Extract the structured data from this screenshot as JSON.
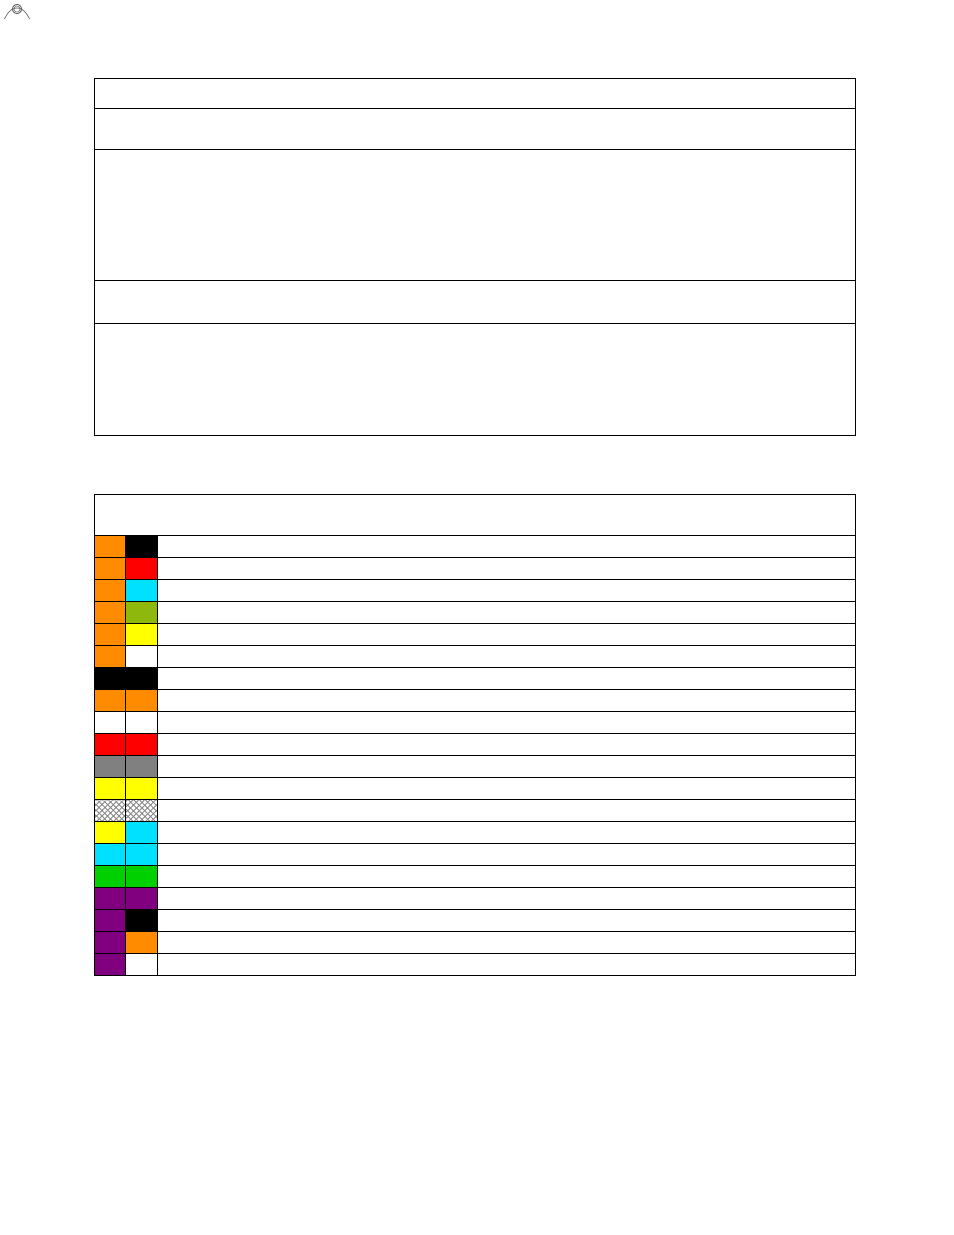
{
  "logo": {
    "name": "mgm-lion-logo"
  },
  "table1": {
    "rows": [
      {
        "id": "r1",
        "content": ""
      },
      {
        "id": "r2",
        "content": ""
      },
      {
        "id": "r3",
        "content": ""
      },
      {
        "id": "r4",
        "content": ""
      },
      {
        "id": "r5",
        "content": ""
      }
    ]
  },
  "table2": {
    "header": "",
    "colors": {
      "orange": "#ff8c00",
      "black": "#000000",
      "red": "#ff0000",
      "cyan": "#00e0ff",
      "olive": "#8fb80d",
      "yellow": "#ffff00",
      "white": "#ffffff",
      "gray": "#808080",
      "green": "#00d000",
      "purple": "#800080"
    },
    "rows": [
      {
        "c1": "orange",
        "c2": "black",
        "label": ""
      },
      {
        "c1": "orange",
        "c2": "red",
        "label": ""
      },
      {
        "c1": "orange",
        "c2": "cyan",
        "label": ""
      },
      {
        "c1": "orange",
        "c2": "olive",
        "label": ""
      },
      {
        "c1": "orange",
        "c2": "yellow",
        "label": ""
      },
      {
        "c1": "orange",
        "c2": "white",
        "label": ""
      },
      {
        "c1": "black",
        "c2": "black",
        "label": ""
      },
      {
        "c1": "orange",
        "c2": "orange",
        "label": ""
      },
      {
        "c1": "white",
        "c2": "white",
        "label": ""
      },
      {
        "c1": "red",
        "c2": "red",
        "label": ""
      },
      {
        "c1": "gray",
        "c2": "gray",
        "label": ""
      },
      {
        "c1": "yellow",
        "c2": "yellow",
        "label": ""
      },
      {
        "c1": "hatch",
        "c2": "hatch",
        "label": ""
      },
      {
        "c1": "yellow",
        "c2": "cyan",
        "label": ""
      },
      {
        "c1": "cyan",
        "c2": "cyan",
        "label": ""
      },
      {
        "c1": "green",
        "c2": "green",
        "label": ""
      },
      {
        "c1": "purple",
        "c2": "purple",
        "label": ""
      },
      {
        "c1": "purple",
        "c2": "black",
        "label": ""
      },
      {
        "c1": "purple",
        "c2": "orange",
        "label": ""
      },
      {
        "c1": "purple",
        "c2": "white",
        "label": ""
      }
    ]
  }
}
